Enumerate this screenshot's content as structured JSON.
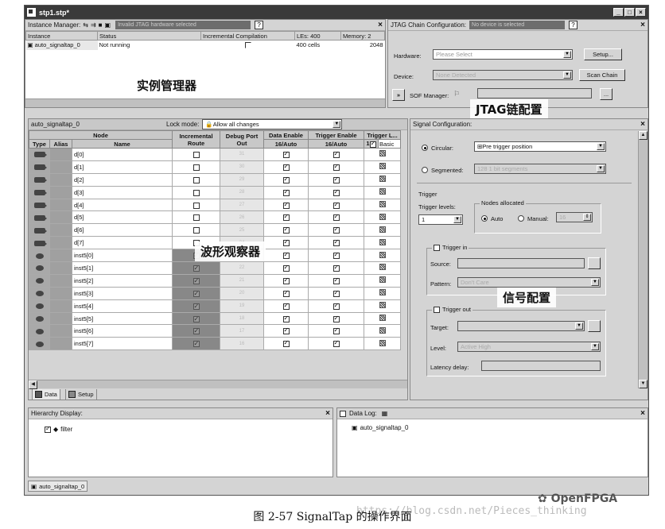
{
  "window": {
    "title": "stp1.stp*",
    "buttons": [
      "_",
      "□",
      "×"
    ]
  },
  "instance_manager": {
    "title": "Instance Manager:",
    "status_bar": "Invalid JTAG hardware selected",
    "columns": [
      "Instance",
      "Status",
      "Incremental Compilation",
      "LEs: 400",
      "Memory: 2"
    ],
    "row": {
      "instance": "auto_signaltap_0",
      "status": "Not running",
      "les": "400 cells",
      "memory": "2048"
    },
    "annotation": "实例管理器"
  },
  "jtag": {
    "title": "JTAG Chain Configuration:",
    "status_bar": "No device is selected",
    "hardware_label": "Hardware:",
    "hardware_value": "Please Select",
    "setup_btn": "Setup...",
    "device_label": "Device:",
    "device_value": "None Detected",
    "scan_btn": "Scan Chain",
    "sof_label": "SOF Manager:",
    "more_btn": "...",
    "annotation": "JTAG链配置"
  },
  "node_list": {
    "instance": "auto_signaltap_0",
    "lock_label": "Lock mode:",
    "lock_value": "Allow all changes",
    "h1": {
      "node": "Node",
      "inc": "Incremental Route",
      "dbg": "Debug Port Out",
      "de": "Data Enable",
      "te": "Trigger Enable",
      "tl": "Trigger L..."
    },
    "h2": {
      "type": "Type",
      "alias": "Alias",
      "name": "Name",
      "de": "16/Auto",
      "te": "16/Auto",
      "tl": "1",
      "basic": "Basic"
    },
    "rows": [
      {
        "name": "d[0]",
        "dbg": "31"
      },
      {
        "name": "d[1]",
        "dbg": "30"
      },
      {
        "name": "d[2]",
        "dbg": "29"
      },
      {
        "name": "d[3]",
        "dbg": "28"
      },
      {
        "name": "d[4]",
        "dbg": "27"
      },
      {
        "name": "d[5]",
        "dbg": "26"
      },
      {
        "name": "d[6]",
        "dbg": "25"
      },
      {
        "name": "d[7]",
        "dbg": "24"
      },
      {
        "name": "inst5[0]",
        "dbg": "23"
      },
      {
        "name": "inst5[1]",
        "dbg": "22"
      },
      {
        "name": "inst5[2]",
        "dbg": "21"
      },
      {
        "name": "inst5[3]",
        "dbg": "20"
      },
      {
        "name": "inst5[4]",
        "dbg": "19"
      },
      {
        "name": "inst5[5]",
        "dbg": "18"
      },
      {
        "name": "inst5[6]",
        "dbg": "17"
      },
      {
        "name": "inst5[7]",
        "dbg": "16"
      }
    ],
    "annotation": "波形观察器",
    "tabs": [
      "Data",
      "Setup"
    ]
  },
  "signal_config": {
    "title": "Signal Configuration:",
    "circular": "Circular:",
    "circular_value": "Pre trigger position",
    "segmented": "Segmented:",
    "segmented_value": "128 1 bit segments",
    "trigger": "Trigger",
    "trigger_levels": "Trigger levels:",
    "levels_value": "1",
    "nodes_allocated": "Nodes allocated",
    "auto": "Auto",
    "manual": "Manual:",
    "manual_value": "16",
    "trigger_in": "Trigger in",
    "source": "Source:",
    "pattern": "Pattern:",
    "pattern_value": "Don't Care",
    "trigger_out": "Trigger out",
    "target": "Target:",
    "level": "Level:",
    "level_value": "Active High",
    "latency": "Latency delay:",
    "annotation": "信号配置"
  },
  "hierarchy": {
    "title": "Hierarchy Display:",
    "item": "filter"
  },
  "datalog": {
    "title": "Data Log:",
    "item": "auto_signaltap_0"
  },
  "bottom_tab": "auto_signaltap_0",
  "caption": "图 2-57    SignalTap 的操作界面",
  "watermark_url": "https://blog.csdn.net/Pieces_thinking",
  "watermark_brand": "OpenFPGA"
}
